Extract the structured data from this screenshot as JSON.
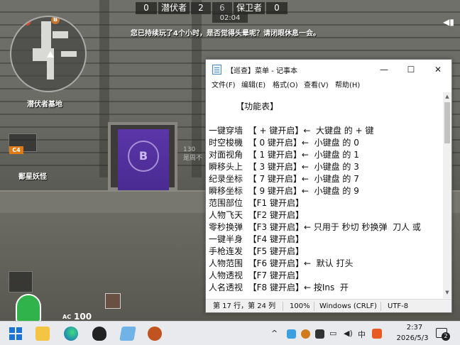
{
  "game": {
    "scoreboard": {
      "left_score": "0",
      "left_team": "潜伏者",
      "left_round": "2",
      "right_round": "6",
      "right_team": "保卫者",
      "right_score": "0"
    },
    "timer": "02:04",
    "notice": "您已持续玩了4个小时，是否觉得头晕呢？请闭眼休息一会。",
    "minimap": {
      "marker_a": "A",
      "marker_b": "B",
      "location": "潜伏者基地"
    },
    "c4_label": "C4",
    "hud_text_2": "鄱星妖怪",
    "bg_text": "130\n是周不",
    "banner_letter": "B",
    "ammo_label": "AC",
    "ammo_value": "100"
  },
  "notepad": {
    "title": "【巡查】菜单 - 记事本",
    "controls": {
      "minimize": "—",
      "maximize": "☐",
      "close": "✕"
    },
    "menus": [
      "文件(F)",
      "编辑(E)",
      "格式(O)",
      "查看(V)",
      "帮助(H)"
    ],
    "lines": [
      "          【功能表】",
      "",
      "一键穿墙  【 + 键开启】←  大键盘 的 + 键",
      "时空梭機  【 0 键开启】←  小键盘 的 0",
      "对面视角  【 1 键开启】←  小键盘 的 1",
      "瞬移头上  【 3 键开启】←  小键盘 的 3",
      "纪录坐标  【 7 键开启】←  小键盘 的 7",
      "瞬移坐标  【 9 键开启】←  小键盘 的 9",
      "范围部位  【F1 键开启】",
      "人物飞天  【F2 键开启】",
      "零秒换弹  【F3 键开启】← 只用于 秒切 秒换弹  刀人 或",
      "一键半身  【F4 键开启】",
      "手枪连发  【F5 键开启】",
      "人物范围  【F6 键开启】←  默认 打头",
      "人物透视  【F7 键开启】",
      "人名透视  【F8 键开启】← 按Ins  开"
    ],
    "status": {
      "position": "第 17 行，第 24 列",
      "zoom": "100%",
      "line_ending": "Windows (CRLF)",
      "encoding": "UTF-8"
    }
  },
  "taskbar": {
    "icons": [
      "windows-start-icon",
      "file-explorer-icon",
      "edge-browser-icon",
      "qq-icon",
      "notepad-icon",
      "game-launcher-icon"
    ],
    "tray": {
      "chevron": "^",
      "ime": "中",
      "notification_count": "2"
    },
    "time": "2:37",
    "date": "2026/5/3"
  }
}
